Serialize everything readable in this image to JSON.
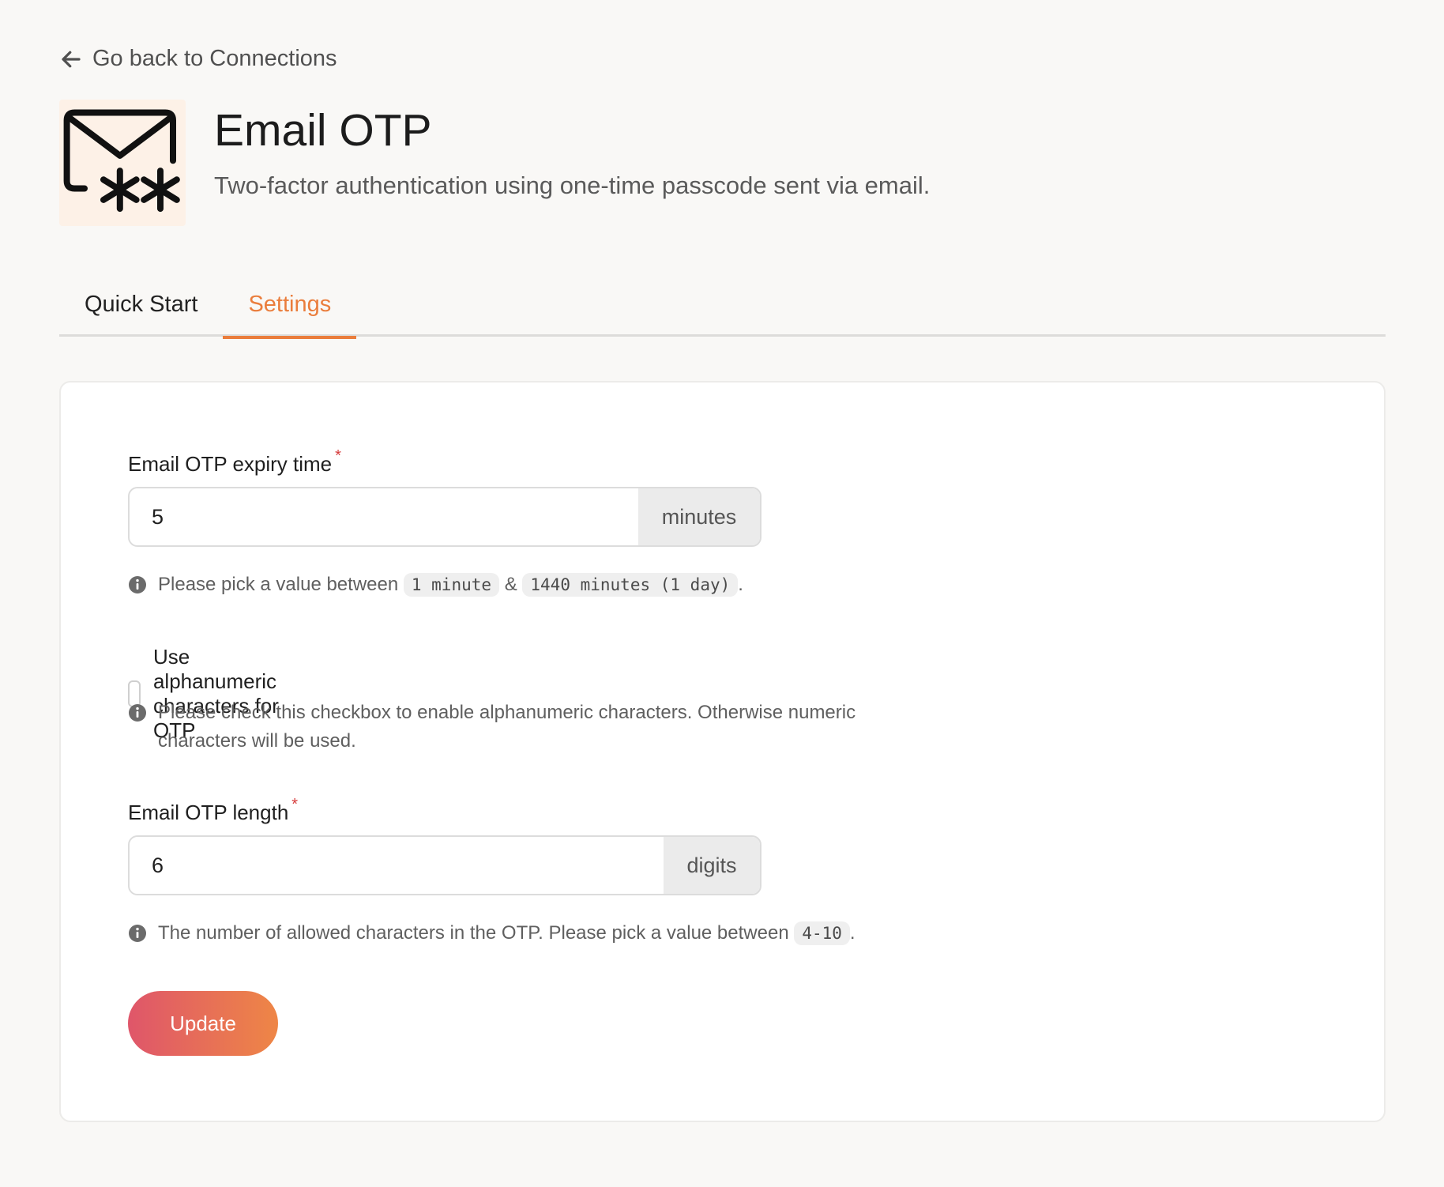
{
  "nav": {
    "back_label": "Go back to Connections"
  },
  "header": {
    "title": "Email OTP",
    "subtitle": "Two-factor authentication using one-time passcode sent via email.",
    "logo_icon": "email-otp-icon"
  },
  "tabs": [
    {
      "label": "Quick Start",
      "active": false
    },
    {
      "label": "Settings",
      "active": true
    }
  ],
  "form": {
    "expiry": {
      "label": "Email OTP expiry time",
      "required_mark": "*",
      "value": "5",
      "unit": "minutes",
      "hint_prefix": "Please pick a value between",
      "hint_min": "1 minute",
      "hint_sep": "&",
      "hint_max": "1440 minutes (1 day)",
      "hint_suffix": "."
    },
    "alphanumeric": {
      "label": "Use alphanumeric characters for OTP",
      "checked": false,
      "hint": "Please check this checkbox to enable alphanumeric characters. Otherwise numeric characters will be used."
    },
    "length": {
      "label": "Email OTP length",
      "required_mark": "*",
      "value": "6",
      "unit": "digits",
      "hint_prefix": "The number of allowed characters in the OTP. Please pick a value between",
      "hint_range": "4-10",
      "hint_suffix": "."
    },
    "submit_label": "Update"
  },
  "colors": {
    "accent": "#ea7d3c",
    "required": "#d63c3c",
    "button_gradient_start": "#df566a",
    "button_gradient_end": "#ee8646"
  }
}
